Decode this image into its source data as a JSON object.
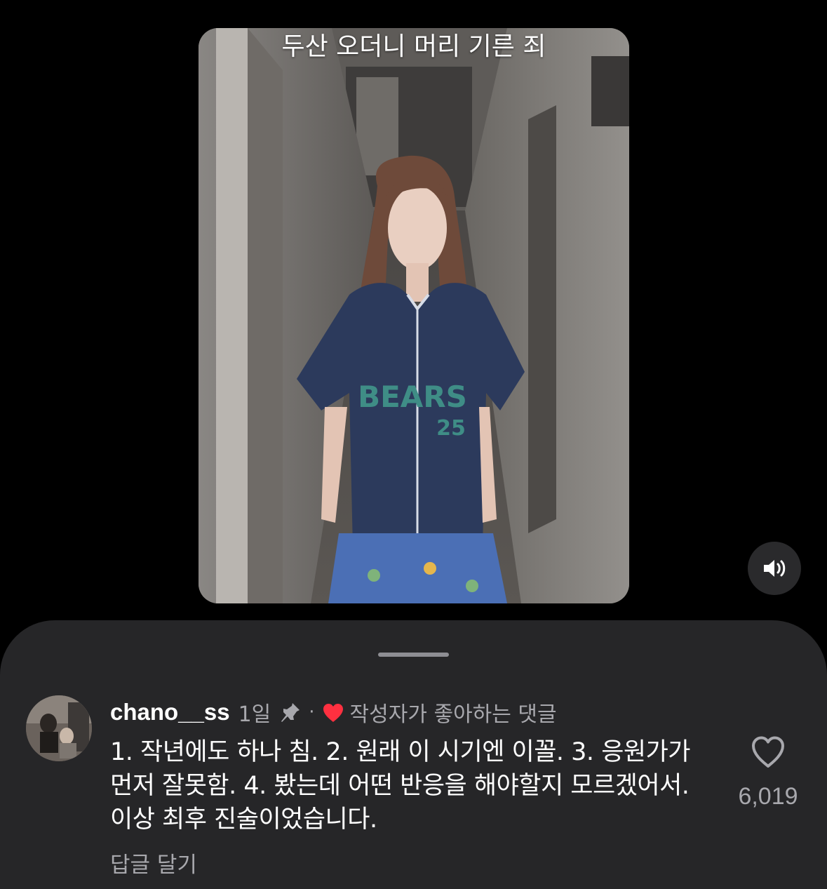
{
  "video": {
    "caption": "두산 오더니 머리 기른 죄",
    "jersey_text": "BEARS",
    "jersey_number": "25",
    "sound_icon": "speaker-icon"
  },
  "comment": {
    "username": "chano__ss",
    "age": "1일",
    "pin_icon": "pin-icon",
    "separator": "·",
    "creator_liked_icon": "red-heart-icon",
    "creator_liked_label": "작성자가 좋아하는 댓글",
    "text": "1. 작년에도 하나 침. 2. 원래 이 시기엔 이꼴. 3. 응원가가 먼저 잘못함. 4. 봤는데 어떤 반응을 해야할지 모르겠어서. 이상 최후 진술이었습니다.",
    "reply_label": "답글 달기",
    "like_icon": "heart-outline-icon",
    "like_count": "6,019"
  },
  "colors": {
    "sheet_background": "#262628",
    "secondary_text": "#a8a8ad",
    "liked_heart": "#ff3040"
  }
}
